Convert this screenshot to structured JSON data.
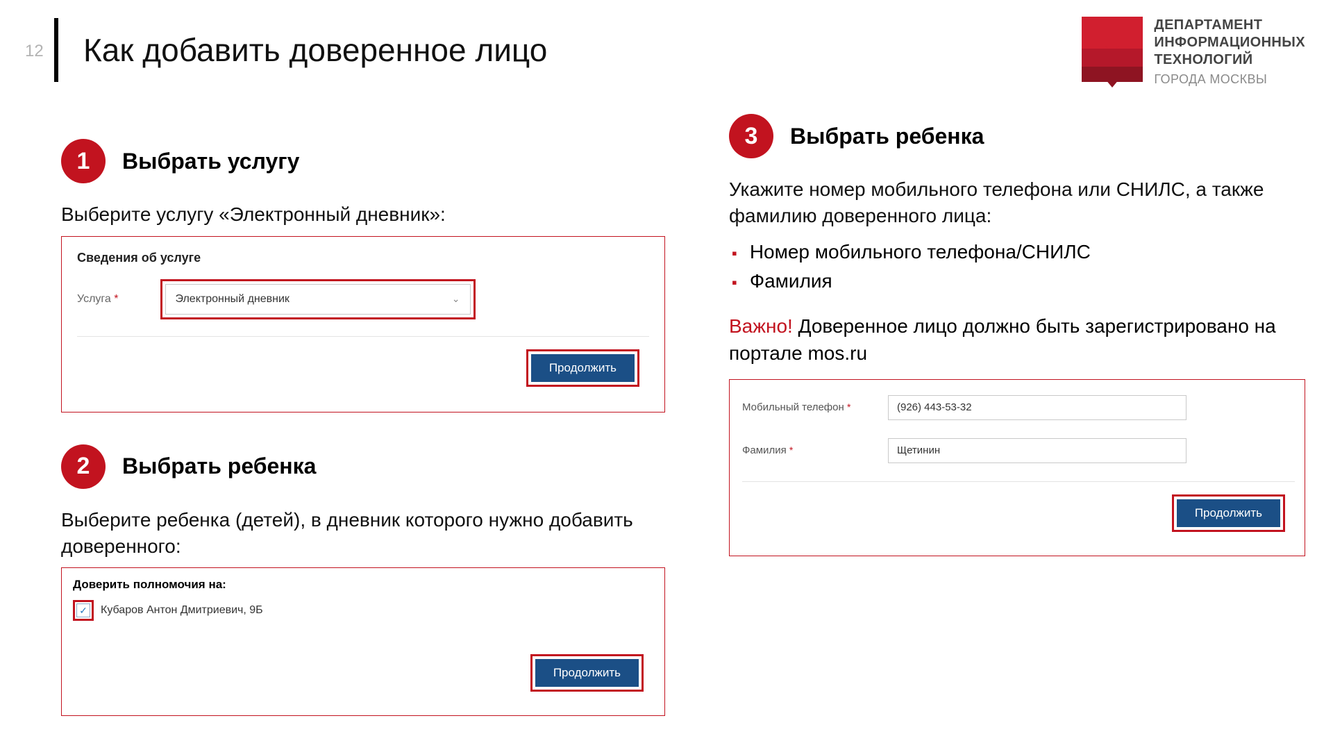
{
  "page_number": "12",
  "title": "Как добавить доверенное лицо",
  "department": {
    "line1": "ДЕПАРТАМЕНТ",
    "line2": "ИНФОРМАЦИОННЫХ",
    "line3": "ТЕХНОЛОГИЙ",
    "line4": "ГОРОДА МОСКВЫ"
  },
  "step1": {
    "num": "1",
    "title": "Выбрать услугу",
    "desc": "Выберите услугу «Электронный дневник»:",
    "panel_label": "Сведения об услуге",
    "field_label": "Услуга",
    "star": "*",
    "select_value": "Электронный дневник",
    "continue": "Продолжить"
  },
  "step2": {
    "num": "2",
    "title": "Выбрать ребенка",
    "desc": "Выберите ребенка (детей), в дневник которого нужно добавить доверенного:",
    "delegate_title": "Доверить полномочия на:",
    "child": "Кубаров Антон Дмитриевич, 9Б",
    "check": "✓",
    "continue": "Продолжить"
  },
  "step3": {
    "num": "3",
    "title": "Выбрать ребенка",
    "desc": "Укажите номер мобильного телефона или СНИЛС, а также фамилию доверенного лица:",
    "bullet1": "Номер мобильного телефона/СНИЛС",
    "bullet2": "Фамилия",
    "warn_label": "Важно!",
    "warn_text": " Доверенное лицо должно быть зарегистрировано на портале mos.ru",
    "phone_label": "Мобильный телефон",
    "phone_value": "(926) 443-53-32",
    "surname_label": "Фамилия",
    "surname_value": "Щетинин",
    "star": "*",
    "continue": "Продолжить"
  }
}
